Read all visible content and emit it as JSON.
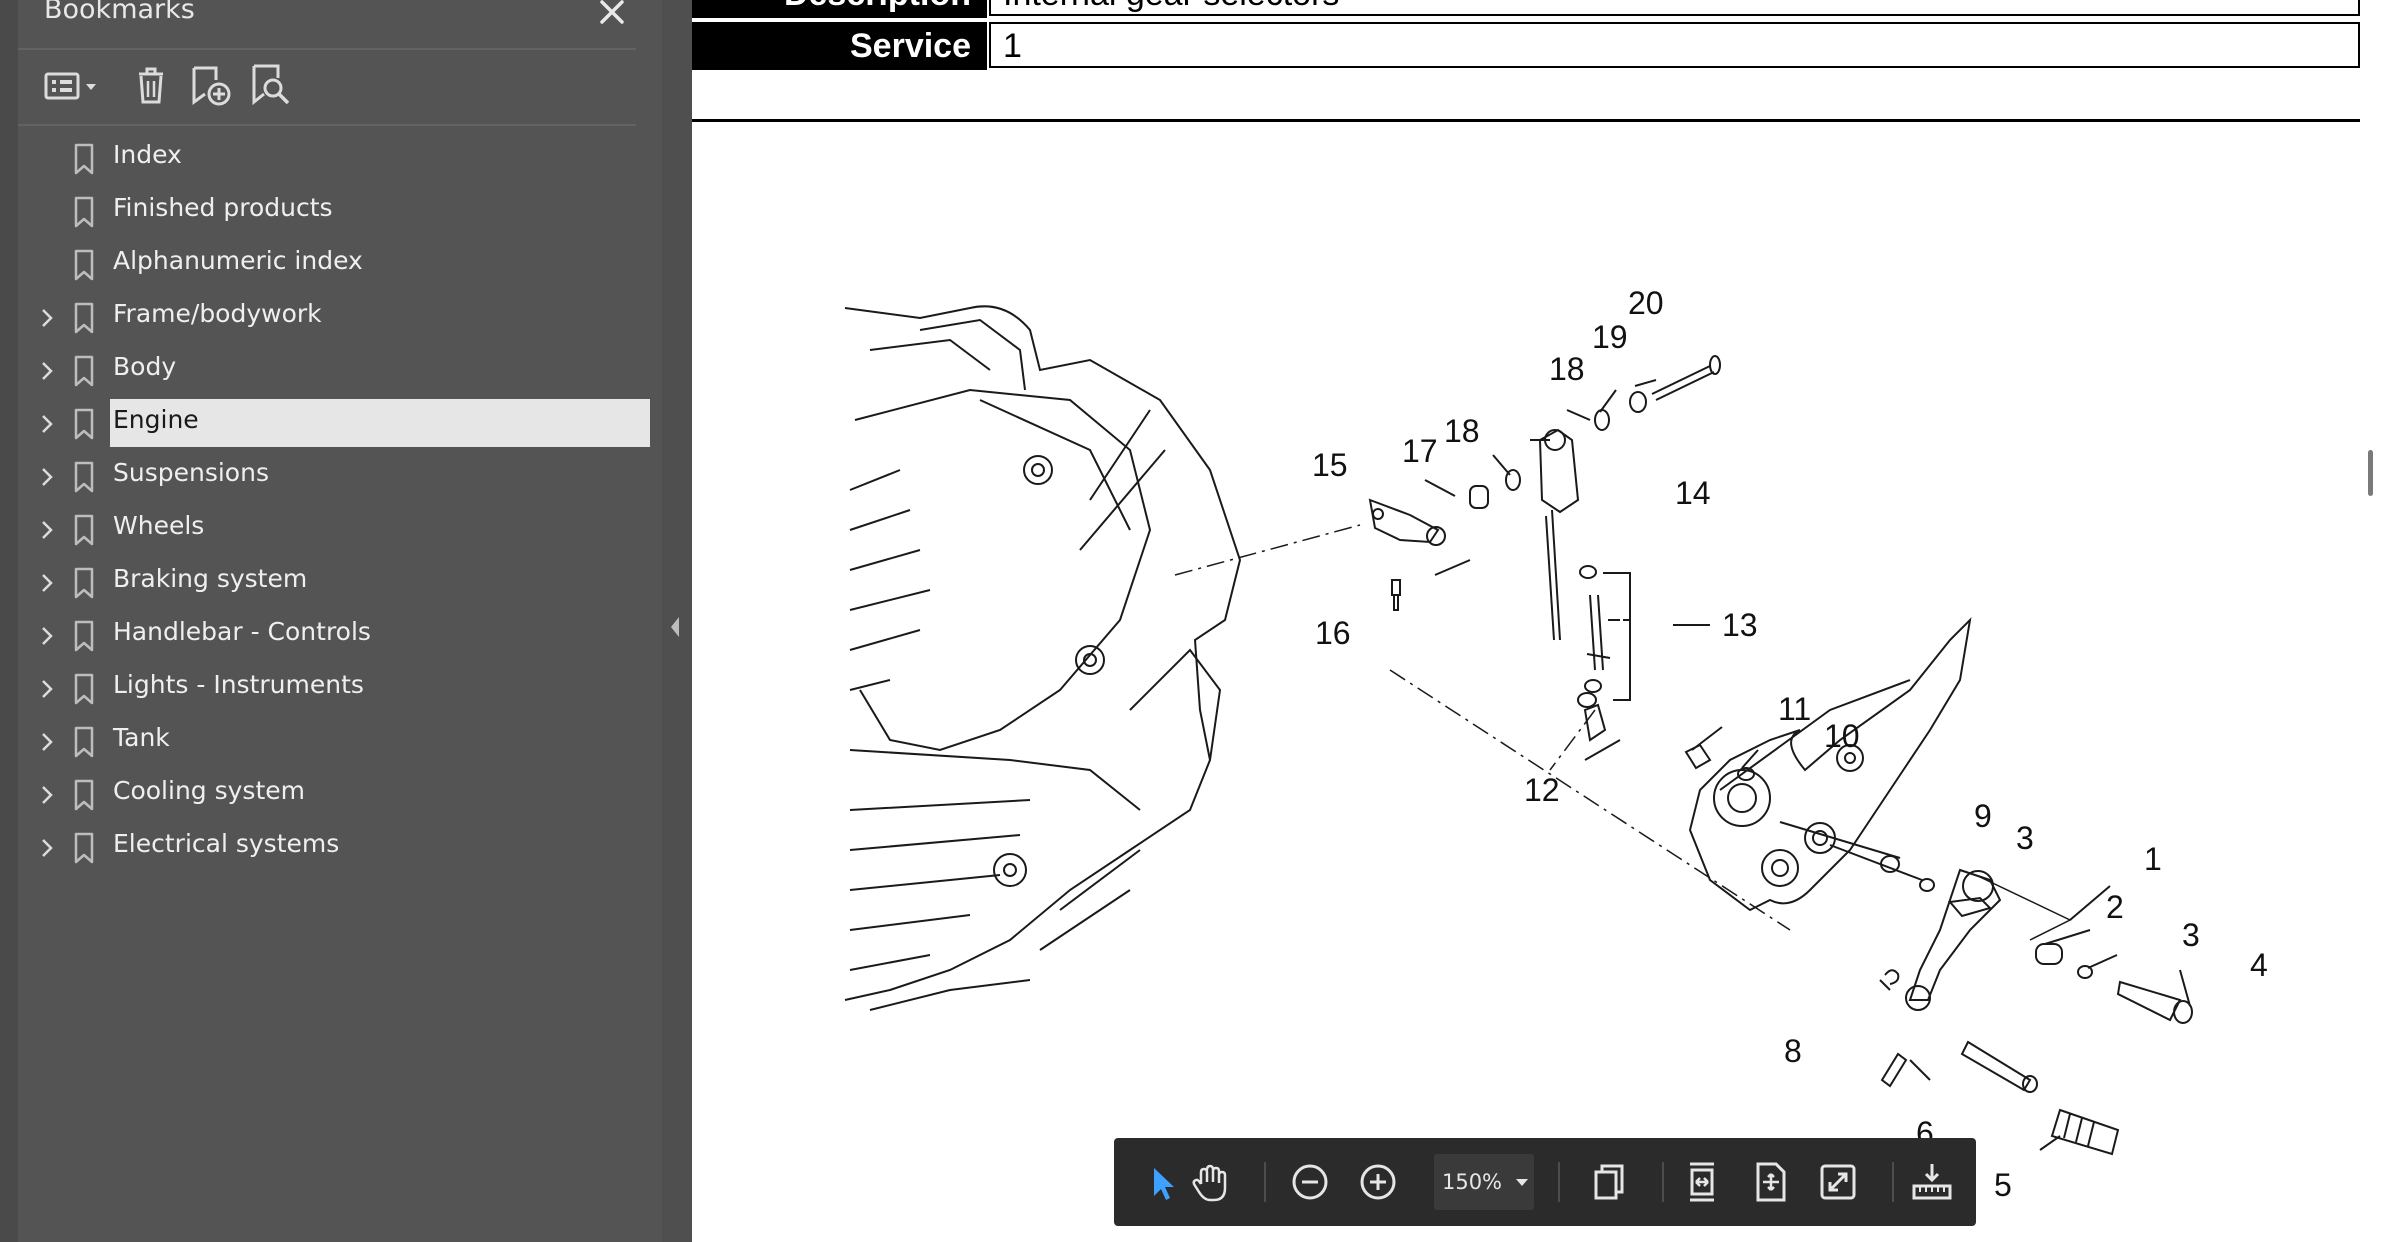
{
  "sidebar": {
    "title": "Bookmarks",
    "toolbar": {
      "icons": [
        "bookmark-options-icon",
        "delete-bookmark-icon",
        "add-bookmark-icon",
        "find-bookmark-icon"
      ]
    },
    "items": [
      {
        "label": "Index",
        "expandable": false
      },
      {
        "label": "Finished products",
        "expandable": false
      },
      {
        "label": "Alphanumeric index",
        "expandable": false
      },
      {
        "label": "Frame/bodywork",
        "expandable": true
      },
      {
        "label": "Body",
        "expandable": true
      },
      {
        "label": "Engine",
        "expandable": true,
        "selected": true
      },
      {
        "label": "Suspensions",
        "expandable": true
      },
      {
        "label": "Wheels",
        "expandable": true
      },
      {
        "label": "Braking system",
        "expandable": true
      },
      {
        "label": "Handlebar - Controls",
        "expandable": true
      },
      {
        "label": "Lights - Instruments",
        "expandable": true
      },
      {
        "label": "Tank",
        "expandable": true
      },
      {
        "label": "Cooling system",
        "expandable": true
      },
      {
        "label": "Electrical systems",
        "expandable": true
      }
    ]
  },
  "document": {
    "table": [
      {
        "header": "Description",
        "value": "Internal gear selectors"
      },
      {
        "header": "Service",
        "value": "1"
      }
    ],
    "callouts": [
      "20",
      "19",
      "18",
      "18",
      "17",
      "15",
      "14",
      "13",
      "16",
      "11",
      "10",
      "12",
      "9",
      "3",
      "1",
      "2",
      "3",
      "4",
      "8",
      "6",
      "5"
    ]
  },
  "toolbar": {
    "zoom": "150%",
    "icons": [
      "select-cursor-icon",
      "hand-pan-icon",
      "zoom-out-icon",
      "zoom-in-icon",
      "page-view-icon",
      "fit-width-icon",
      "fit-page-icon",
      "full-screen-icon",
      "measure-icon"
    ]
  },
  "colors": {
    "sidebar_bg": "#545454",
    "selected_bg": "#e6e6e6",
    "toolbar_bg": "#2b2b2b",
    "accent": "#3ea0ff"
  }
}
